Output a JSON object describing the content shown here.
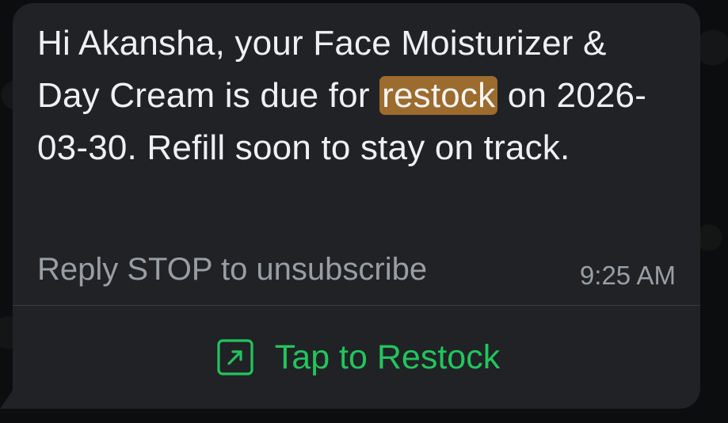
{
  "message": {
    "text_before": "Hi Akansha, your Face Moisturizer & Day Cream is due for ",
    "highlighted_word": "restock",
    "text_after": " on 2026-03-30. Refill soon to stay on track.",
    "unsubscribe_text": "Reply STOP to unsubscribe",
    "timestamp": "9:25 AM"
  },
  "action": {
    "label": "Tap to Restock",
    "icon": "external-link-icon",
    "color": "#23c45e"
  },
  "colors": {
    "bubble": "#202225",
    "highlight": "#9c6b2e",
    "background": "#0b0d0e"
  }
}
